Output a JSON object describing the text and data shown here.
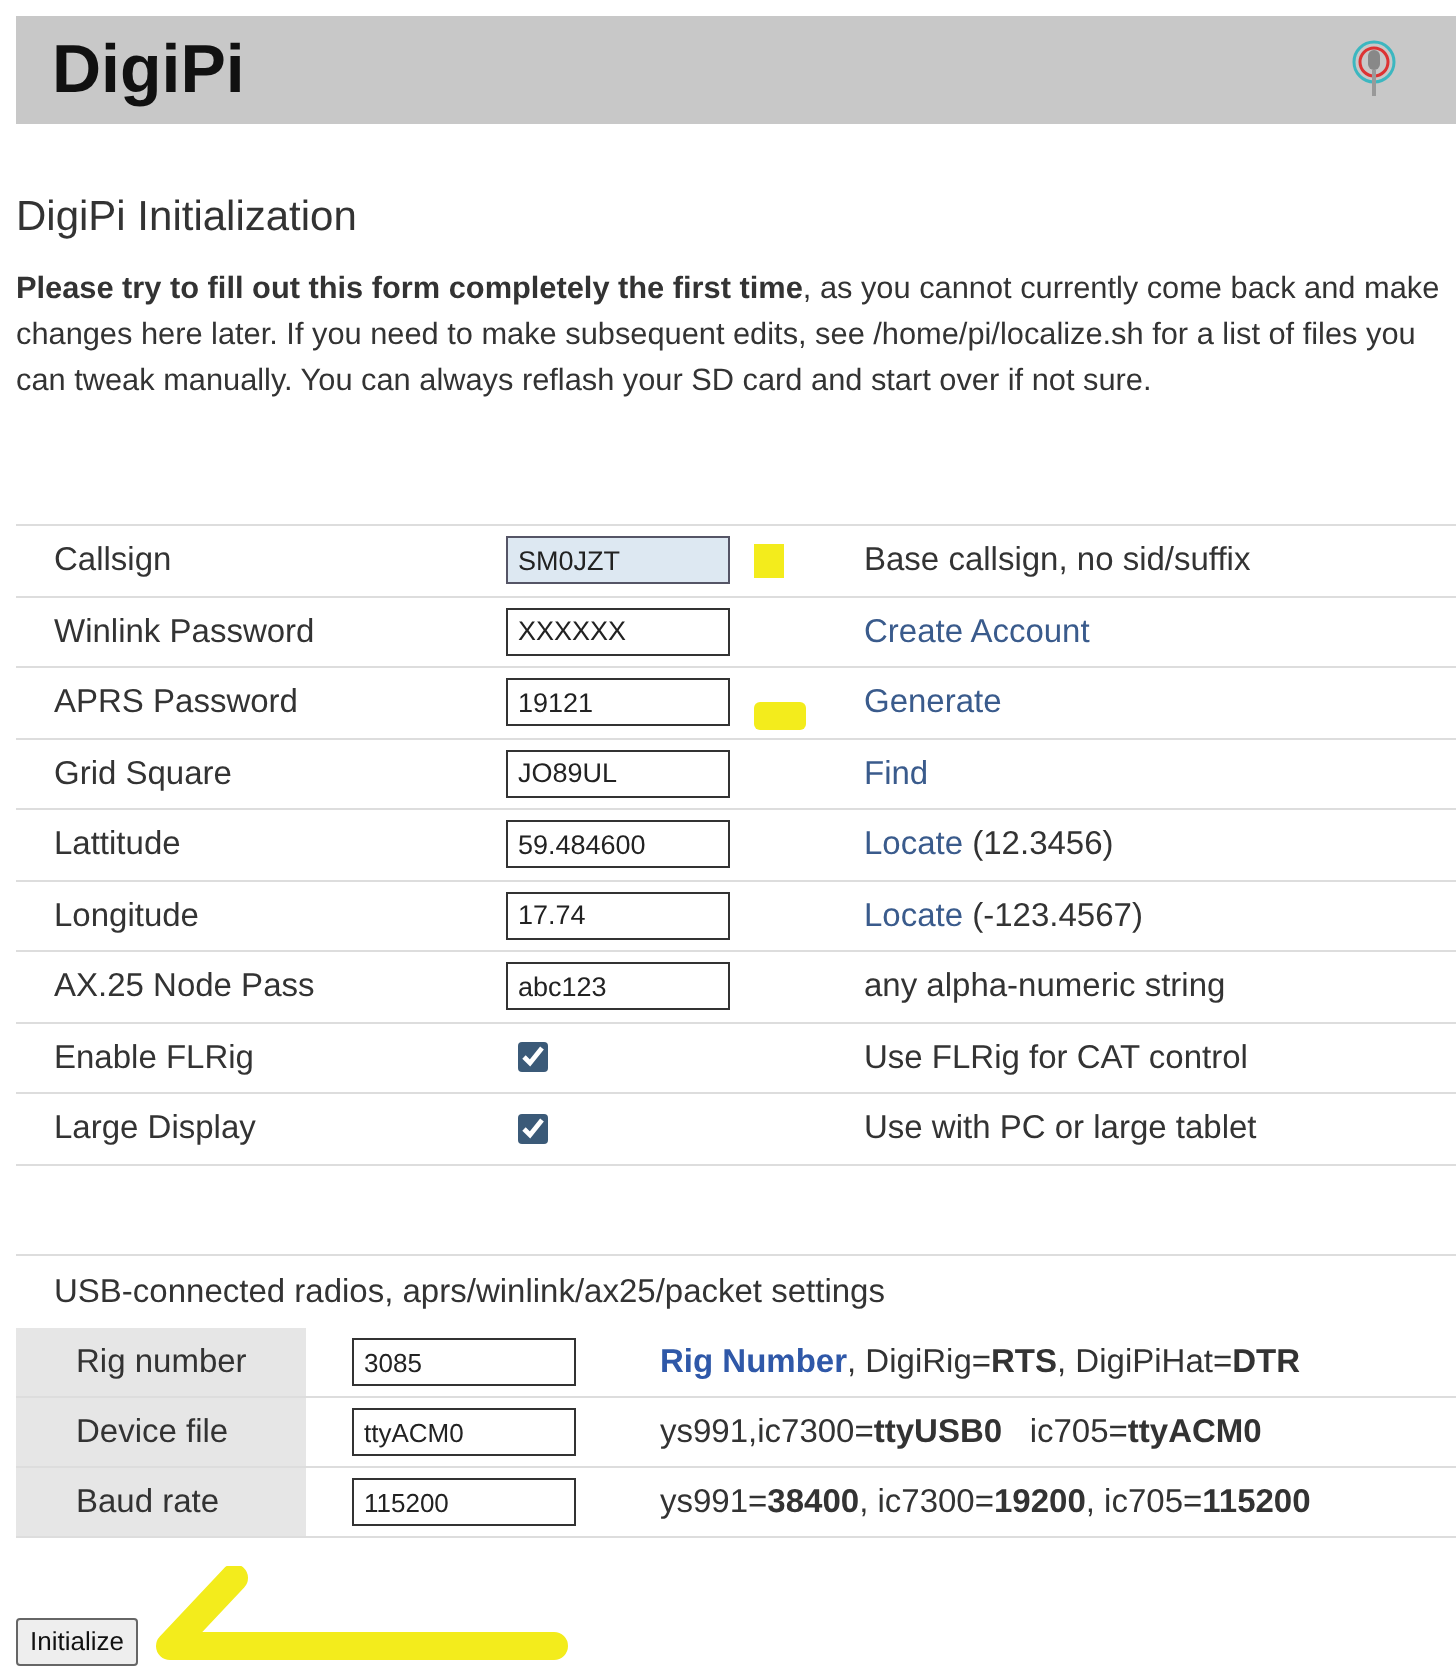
{
  "header": {
    "title": "DigiPi"
  },
  "heading": "DigiPi Initialization",
  "intro": "**Please try to fill out this form completely the first time**, as you cannot currently come back and make changes here later. If you need to make subsequent edits, see /home/pi/localize.sh for a list of files you can tweak manually. You can always reflash your SD card and start over if not sure.",
  "settings": [
    {
      "label": "Callsign",
      "kind": "text",
      "value": "SM0JZT",
      "focused": true,
      "note": "Base callsign, no sid/suffix"
    },
    {
      "label": "Winlink Password",
      "kind": "text",
      "value": "XXXXXX",
      "focused": false,
      "link": "Create Account"
    },
    {
      "label": "APRS Password",
      "kind": "text",
      "value": "19121",
      "focused": false,
      "link": "Generate"
    },
    {
      "label": "Grid Square",
      "kind": "text",
      "value": "JO89UL",
      "focused": false,
      "link": "Find"
    },
    {
      "label": "Lattitude",
      "kind": "text",
      "value": "59.484600",
      "focused": false,
      "link": "Locate",
      "note": "(12.3456)"
    },
    {
      "label": "Longitude",
      "kind": "text",
      "value": "17.74",
      "focused": false,
      "link": "Locate",
      "note": "(-123.4567)"
    },
    {
      "label": "AX.25 Node Pass",
      "kind": "text",
      "value": "abc123",
      "focused": false,
      "note": "any alpha-numeric string"
    },
    {
      "label": "Enable FLRig",
      "kind": "checkbox",
      "checked": true,
      "note": "Use FLRig for CAT control"
    },
    {
      "label": "Large Display",
      "kind": "checkbox",
      "checked": true,
      "note": "Use with PC or large tablet"
    }
  ],
  "radio_section": {
    "title": "USB-connected radios, aprs/winlink/ax25/packet settings",
    "rows": [
      {
        "label": "Rig number",
        "value": "3085",
        "link": "Rig Number",
        "note": ", DigiRig=**RTS**, DigiPiHat=**DTR**"
      },
      {
        "label": "Device file",
        "value": "ttyACM0",
        "note": "ys991,ic7300=**ttyUSB0**   ic705=**ttyACM0**"
      },
      {
        "label": "Baud rate",
        "value": "115200",
        "note": "ys991=**38400**, ic7300=**19200**, ic705=**115200**"
      }
    ]
  },
  "submit": "Initialize"
}
